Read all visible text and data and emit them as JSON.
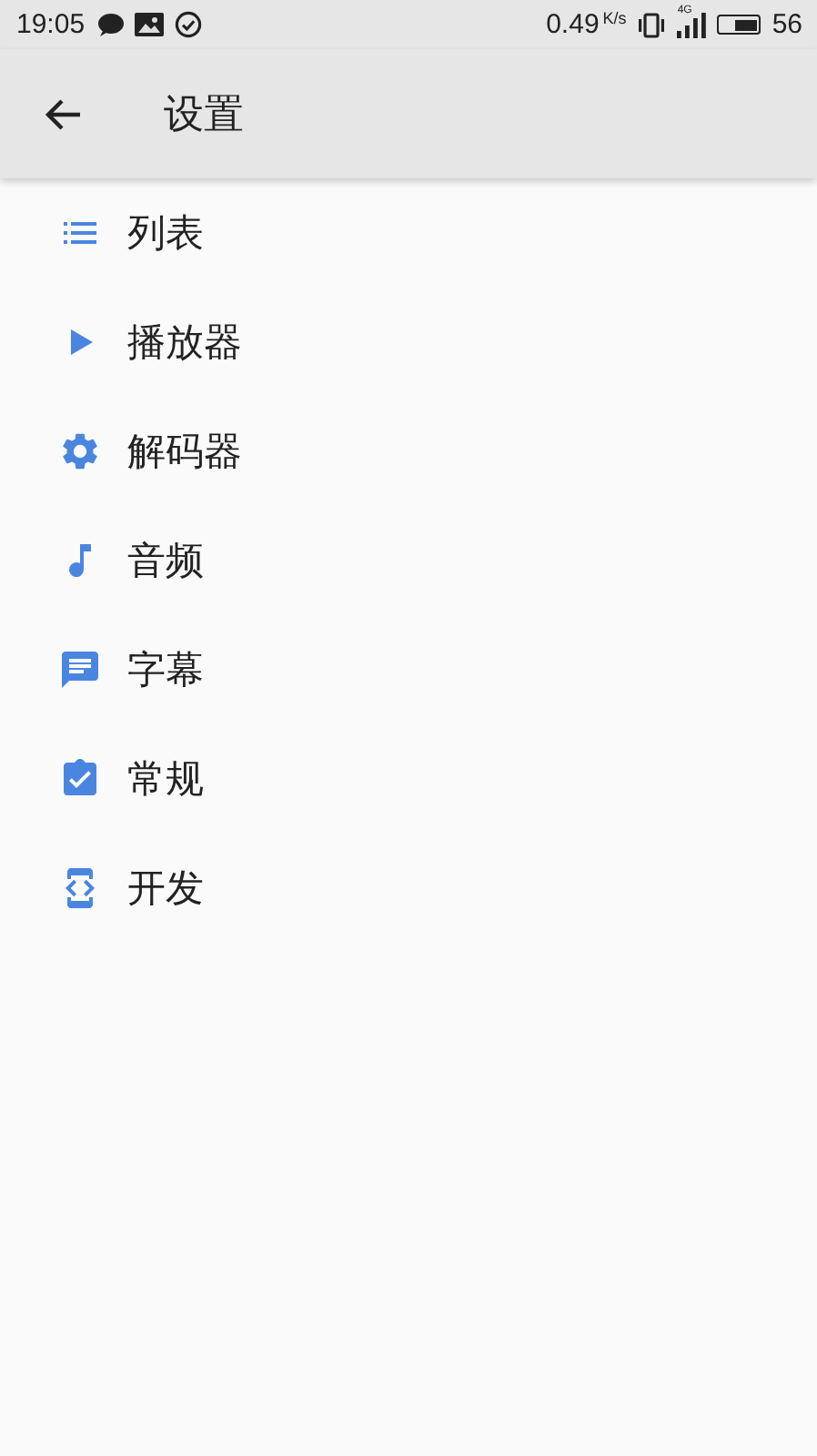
{
  "status_bar": {
    "time": "19:05",
    "speed": "0.49",
    "speed_unit": "K/s",
    "network": "4G",
    "battery": "56"
  },
  "app_bar": {
    "title": "设置"
  },
  "items": [
    {
      "kind": "list",
      "label": "列表"
    },
    {
      "kind": "play",
      "label": "播放器"
    },
    {
      "kind": "gear",
      "label": "解码器"
    },
    {
      "kind": "note",
      "label": "音频"
    },
    {
      "kind": "message",
      "label": "字幕"
    },
    {
      "kind": "clipboard",
      "label": "常规"
    },
    {
      "kind": "code",
      "label": "开发"
    }
  ]
}
